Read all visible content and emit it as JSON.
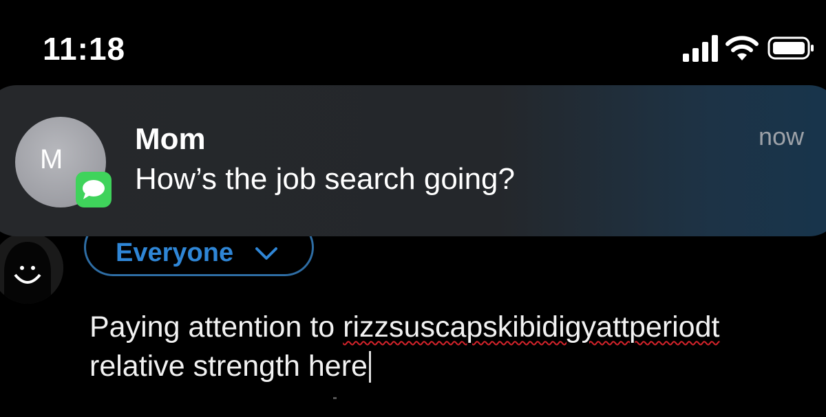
{
  "status_bar": {
    "time": "11:18",
    "icons": [
      "cellular-signal-icon",
      "wifi-icon",
      "battery-icon"
    ]
  },
  "notification": {
    "avatar_initial": "M",
    "app_icon": "messages-app-icon",
    "sender": "Mom",
    "message": "How’s the job search going?",
    "time": "now"
  },
  "composer": {
    "audience_label": "Everyone",
    "audience_icon": "chevron-down-icon",
    "text_start": "Paying attention to ",
    "misspelled_word": "rizzsuscapskibidigyattperiodt",
    "text_end": "relative strength here"
  },
  "colors": {
    "background": "#000000",
    "banner": "#26282b",
    "accent_blue": "#2f86d6",
    "messages_green": "#3fd35b",
    "spellcheck_red": "#d6232b"
  }
}
